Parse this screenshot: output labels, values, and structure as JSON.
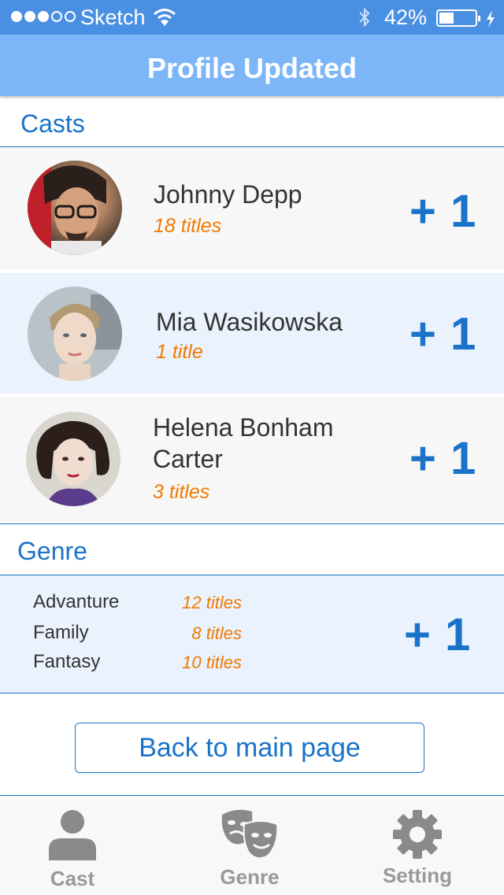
{
  "status_bar": {
    "carrier": "Sketch",
    "battery_percent": "42%",
    "battery_level": 0.42,
    "signal_dots_filled": 3,
    "signal_dots_total": 5,
    "icons": [
      "wifi-icon",
      "bluetooth-icon",
      "battery-icon",
      "charging-bolt-icon"
    ]
  },
  "header": {
    "title": "Profile Updated"
  },
  "casts": {
    "title": "Casts",
    "items": [
      {
        "name": "Johnny Depp",
        "count": "18 titles",
        "delta": "+ 1"
      },
      {
        "name": "Mia Wasikowska",
        "count": "1 title",
        "delta": "+ 1"
      },
      {
        "name_line1": "Helena Bonham",
        "name_line2": "Carter",
        "count": "3 titles",
        "delta": "+ 1"
      }
    ]
  },
  "genre": {
    "title": "Genre",
    "items": [
      {
        "name": "Advanture",
        "count": "12 titles"
      },
      {
        "name": "Family",
        "count": "8 titles"
      },
      {
        "name": "Fantasy",
        "count": "10 titles"
      }
    ],
    "delta": "+ 1"
  },
  "back_button": {
    "label": "Back to main page"
  },
  "tabbar": {
    "tabs": [
      {
        "label": "Cast",
        "icon": "person-icon"
      },
      {
        "label": "Genre",
        "icon": "theater-masks-icon"
      },
      {
        "label": "Setting",
        "icon": "gear-icon"
      }
    ]
  },
  "colors": {
    "status_bar": "#4a90e2",
    "header": "#7cb6f8",
    "accent_blue": "#1a73c8",
    "accent_orange": "#f07a00",
    "row_grey": "#f7f7f7",
    "row_blue": "#eaf2fd"
  }
}
